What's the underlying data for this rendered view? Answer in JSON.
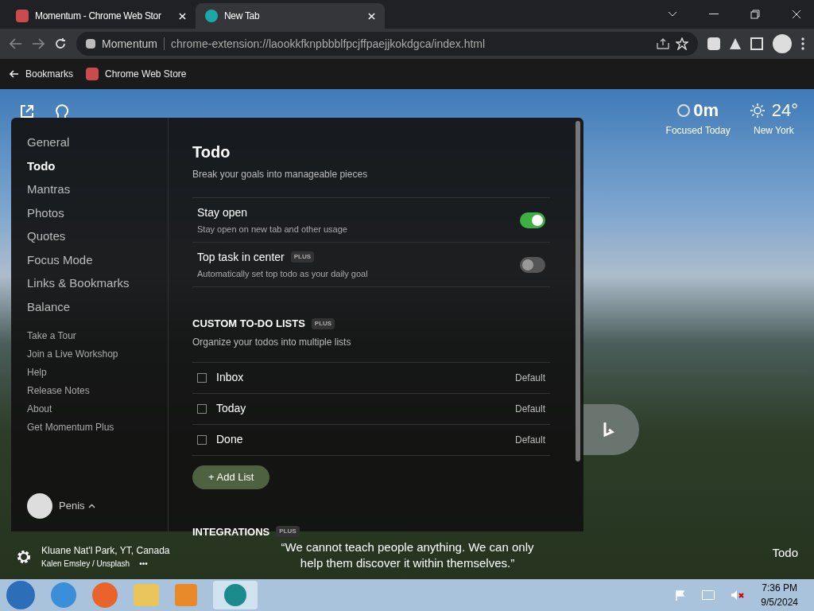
{
  "tabs": [
    {
      "title": "Momentum - Chrome Web Stor",
      "selected": false,
      "kind": "store"
    },
    {
      "title": "New Tab",
      "selected": true,
      "kind": "momentum"
    }
  ],
  "address": {
    "site": "Momentum",
    "url": "chrome-extension://laookkfknpbbblfpcjffpaejjkokdgca/index.html"
  },
  "bookmarks": [
    "Bookmarks",
    "Chrome Web Store"
  ],
  "focus": {
    "value": "0m",
    "label": "Focused Today"
  },
  "weather": {
    "temp": "24°",
    "city": "New York"
  },
  "nav": [
    {
      "label": "General",
      "selected": false
    },
    {
      "label": "Todo",
      "selected": true
    },
    {
      "label": "Mantras",
      "selected": false
    },
    {
      "label": "Photos",
      "selected": false
    },
    {
      "label": "Quotes",
      "selected": false
    },
    {
      "label": "Focus Mode",
      "selected": false
    },
    {
      "label": "Links & Bookmarks",
      "selected": false
    },
    {
      "label": "Balance",
      "selected": false
    }
  ],
  "links": [
    "Take a Tour",
    "Join a Live Workshop",
    "Help",
    "Release Notes",
    "About",
    "Get Momentum Plus"
  ],
  "user": "Penis",
  "settings": {
    "title": "Todo",
    "subtitle": "Break your goals into manageable pieces",
    "toggles": [
      {
        "label": "Stay open",
        "desc": "Stay open on new tab and other usage",
        "on": true
      },
      {
        "label": "Top task in center",
        "badge": "PLUS",
        "desc": "Automatically set top todo as your daily goal",
        "on": false
      }
    ],
    "lists_title": "CUSTOM TO-DO LISTS",
    "lists_badge": "PLUS",
    "lists_desc": "Organize your todos into multiple lists",
    "lists": [
      {
        "name": "Inbox",
        "tag": "Default"
      },
      {
        "name": "Today",
        "tag": "Default"
      },
      {
        "name": "Done",
        "tag": "Default"
      }
    ],
    "add_button": "+ Add List",
    "integrations_title": "INTEGRATIONS",
    "integrations_badge": "PLUS"
  },
  "photo": {
    "location": "Kluane Nat'l Park, YT, Canada",
    "credit": "Kalen Emsley / Unsplash",
    "more": "•••"
  },
  "quote": "“We cannot teach people anything. We can only help them discover it within themselves.”",
  "todo_link": "Todo",
  "clock": {
    "time": "7:36 PM",
    "date": "9/5/2024"
  }
}
